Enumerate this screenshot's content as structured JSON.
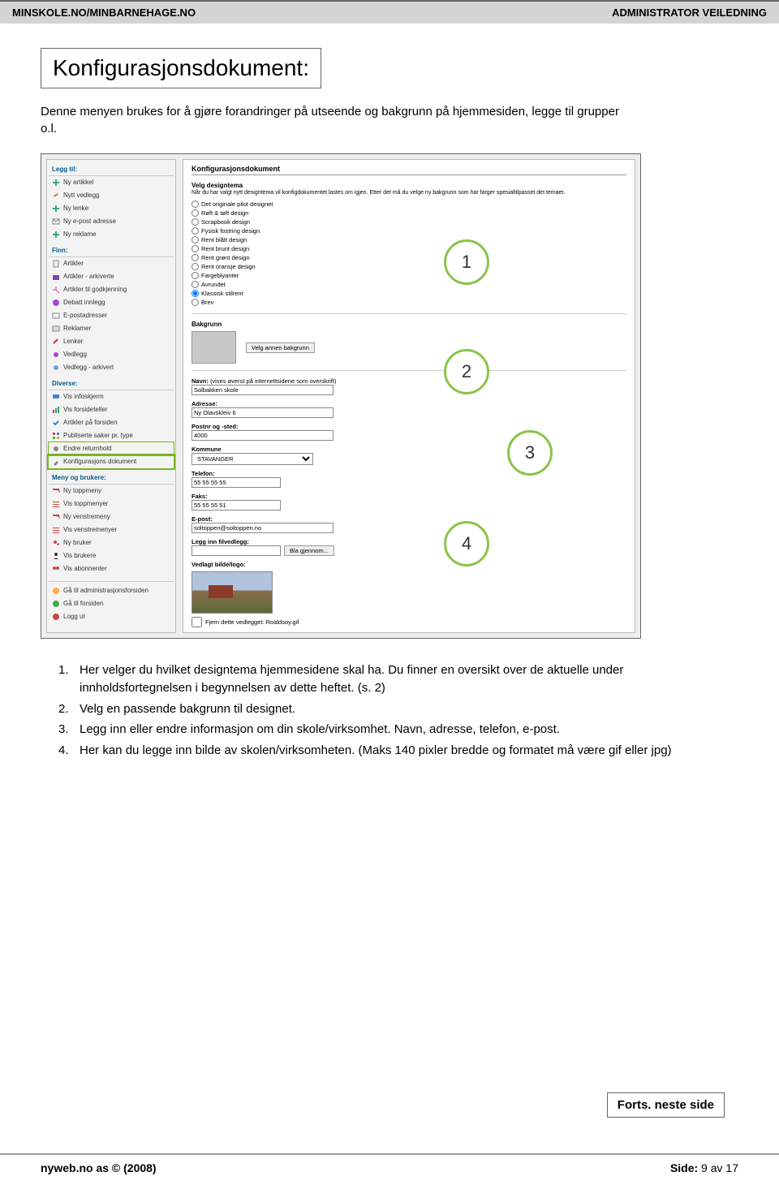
{
  "header": {
    "left": "MINSKOLE.NO/MINBARNEHAGE.NO",
    "right": "ADMINISTRATOR VEILEDNING"
  },
  "title": "Konfigurasjonsdokument:",
  "intro": "Denne menyen brukes for å gjøre forandringer på utseende og bakgrunn på hjemmesiden, legge til grupper o.l.",
  "callouts": {
    "n1": "1",
    "n2": "2",
    "n3": "3",
    "n4": "4"
  },
  "sidebar": {
    "sec1": {
      "title": "Legg til:",
      "items": [
        "Ny artikkel",
        "Nytt vedlegg",
        "Ny lenke",
        "Ny e-post adresse",
        "Ny reklame"
      ]
    },
    "sec2": {
      "title": "Finn:",
      "items": [
        "Artikler",
        "Artikler - arkiverte",
        "Artikler til godkjenning",
        "Debatt innlegg",
        "E-postadresser",
        "Reklamer",
        "Lenker",
        "Vedlegg",
        "Vedlegg - arkivert"
      ]
    },
    "sec3": {
      "title": "Diverse:",
      "items": [
        "Vis infoskjerm",
        "Vis forsideteller",
        "Artikler på forsiden",
        "Publiserte saker pr. type",
        "Endre returnhold",
        "Konfigurasjons dokument"
      ]
    },
    "sec4": {
      "title": "Meny og brukere:",
      "items": [
        "Ny toppmeny",
        "Vis toppmenyer",
        "Ny venstremeny",
        "Vis venstremenyer",
        "Ny bruker",
        "Vis brukere",
        "Vis abonnenter"
      ]
    },
    "sec5": {
      "items": [
        "Gå til administrasjonsforsiden",
        "Gå til forsiden",
        "Logg ut"
      ]
    }
  },
  "main": {
    "title": "Konfigurasjonsdokument",
    "design": {
      "title": "Velg designtema",
      "desc": "Når du har valgt nytt designtema vil konfigdokumentet lastes om igjen. Etter det må du velge ny bakgrunn som har farger spesialtilpasset det temaet.",
      "options": [
        "Det originale pilot designet",
        "Røft & tøft design",
        "Scrapbook design",
        "Fysisk fostring design",
        "Rent blått design",
        "Rent brunt design",
        "Rent grønt design",
        "Rent oransje design",
        "Fargeblyanter",
        "Avrundet",
        "Klassisk stilrent",
        "Brev"
      ],
      "selected": 10
    },
    "bakgrunn": {
      "title": "Bakgrunn",
      "btn": "Velg annen bakgrunn"
    },
    "fields": {
      "navn_label": "Navn:",
      "navn_desc": "(vises øverst på internettsidene som overskrift)",
      "navn_val": "Solbakken skole",
      "adresse_label": "Adresse:",
      "adresse_val": "Ny Olavskleiv 6",
      "post_label": "Postnr og -sted:",
      "post_val": "4000",
      "kommune_label": "Kommune",
      "kommune_val": "STAVANGER",
      "telefon_label": "Telefon:",
      "telefon_val": "55 55 55 55",
      "faks_label": "Faks:",
      "faks_val": "55 55 55 51",
      "epost_label": "E-post:",
      "epost_val": "soltoppen@soltoppen.no",
      "vedlegg_label": "Legg inn filvedlegg:",
      "vedlegg_btn": "Bla gjennom...",
      "logo_label": "Vedlagt bilde/logo:",
      "fjern_label": "Fjern dette vedlegget: Roaldsoy.gif"
    }
  },
  "explain": {
    "i1": {
      "n": "1.",
      "t": "Her velger du hvilket designtema hjemmesidene skal ha. Du finner en oversikt over de aktuelle under innholdsfortegnelsen i begynnelsen av dette heftet. (s. 2)"
    },
    "i2": {
      "n": "2.",
      "t": "Velg en passende bakgrunn til designet."
    },
    "i3": {
      "n": "3.",
      "t": "Legg inn eller endre informasjon om din skole/virksomhet. Navn, adresse, telefon, e-post."
    },
    "i4": {
      "n": "4.",
      "t": "Her kan du legge inn bilde av skolen/virksomheten. (Maks 140 pixler bredde og formatet må være gif eller jpg)"
    }
  },
  "forts": "Forts. neste side",
  "footer": {
    "left": "nyweb.no as © (2008)",
    "right_lab": "Side:",
    "right_val": " 9 av 17"
  }
}
